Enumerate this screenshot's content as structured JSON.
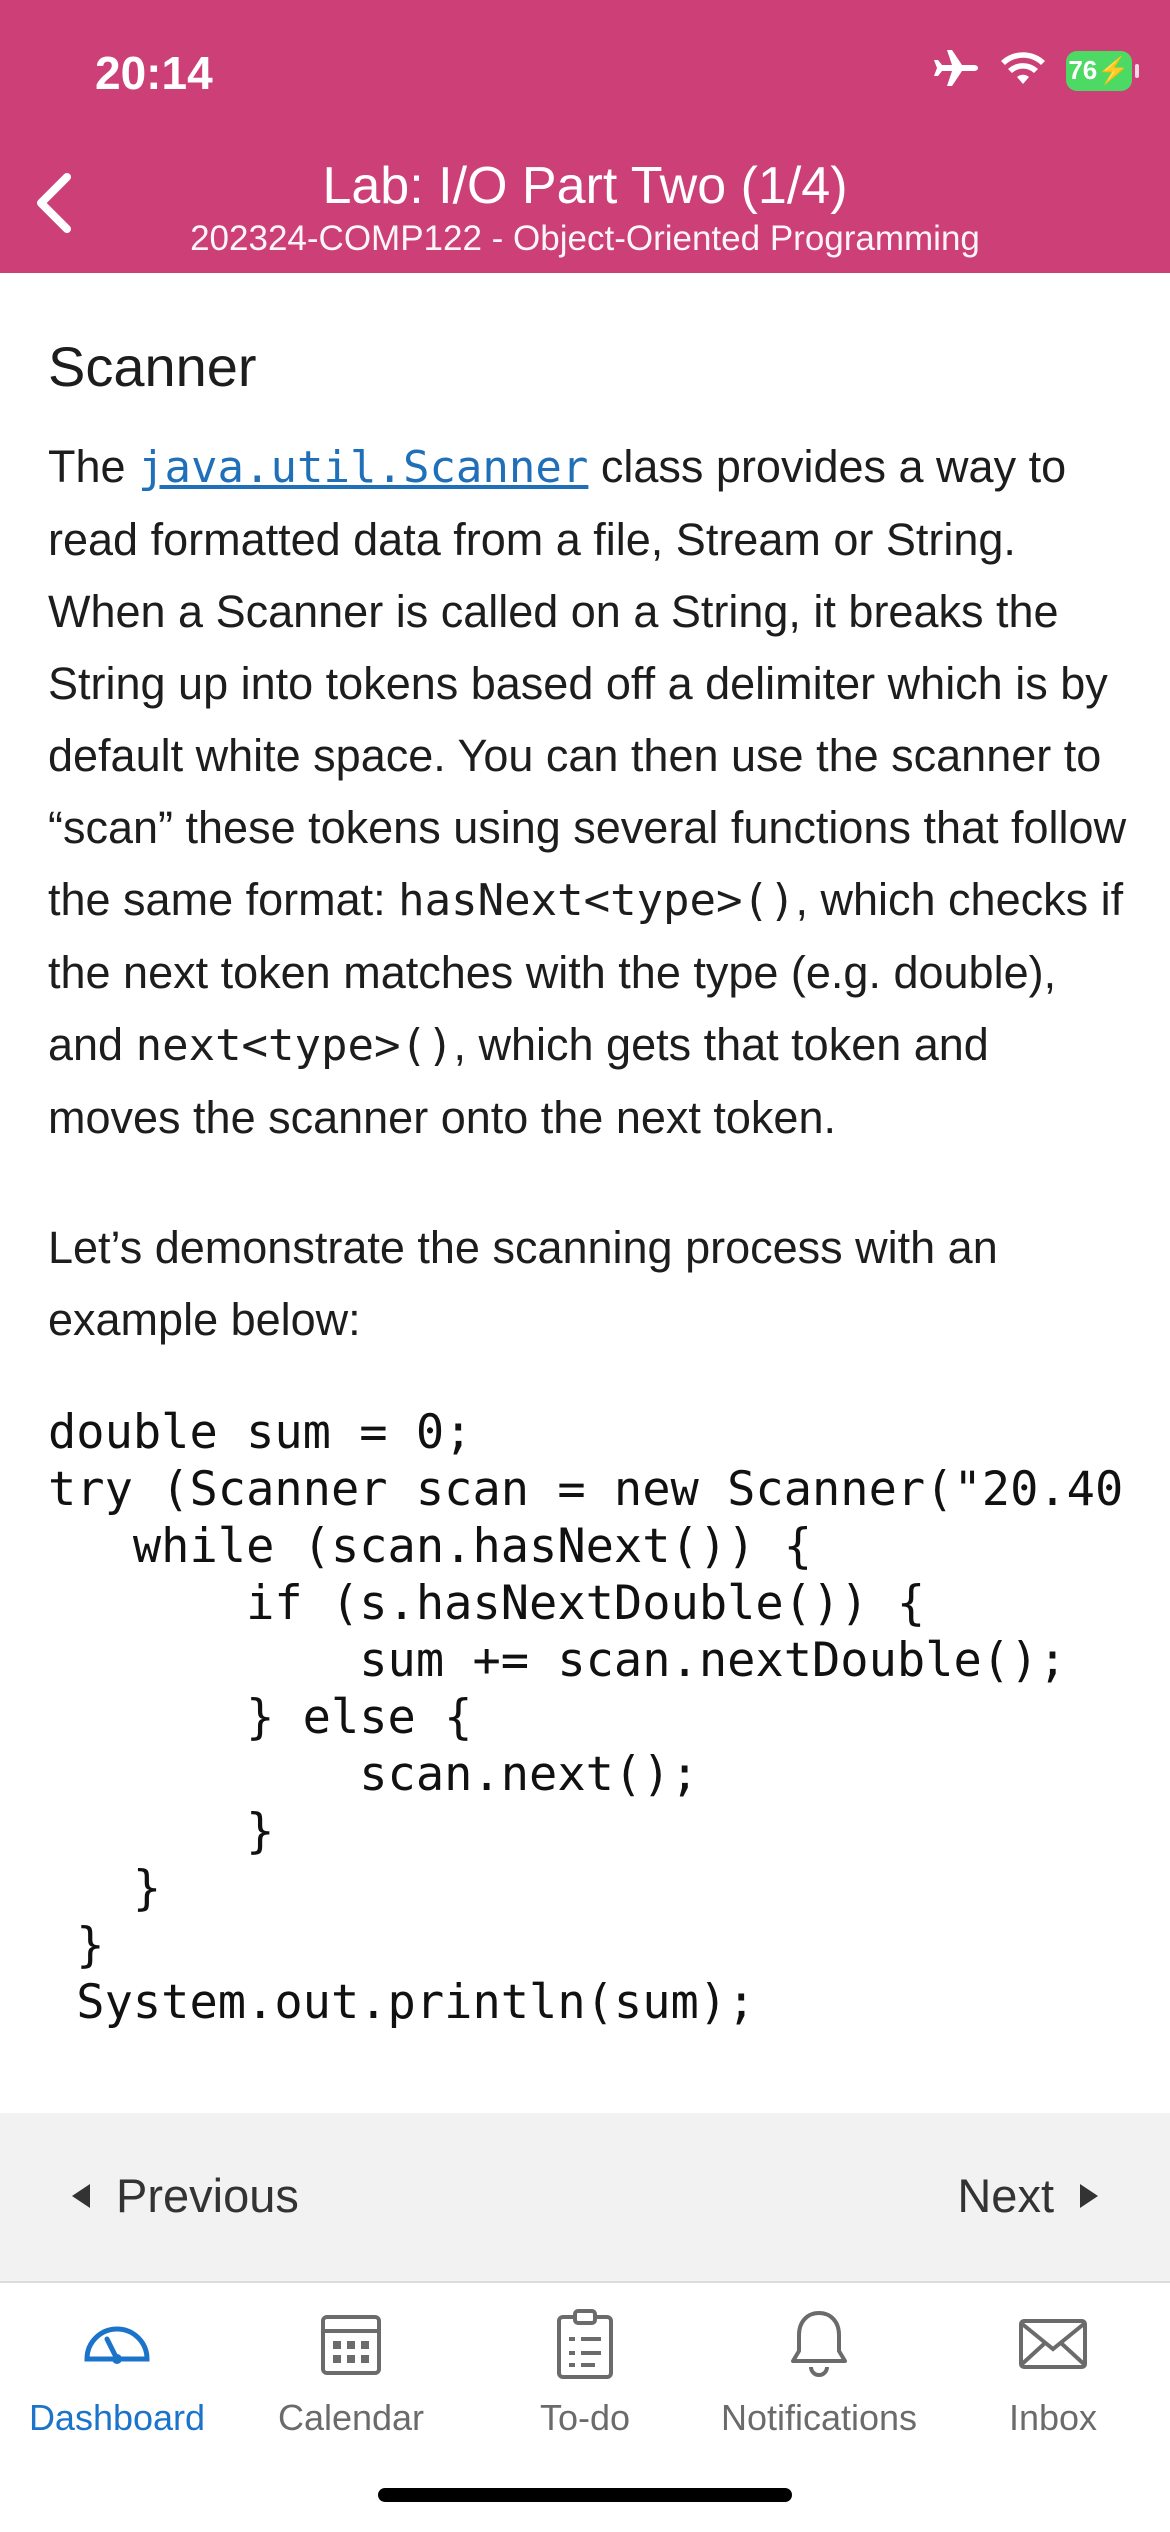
{
  "status_bar": {
    "time": "20:14",
    "battery": "76"
  },
  "header": {
    "title": "Lab: I/O Part Two (1/4)",
    "subtitle": "202324-COMP122 - Object-Oriented Programming"
  },
  "content": {
    "section_title": "Scanner",
    "para1": {
      "t1": "The ",
      "link": "java.util.Scanner",
      "t2": " class provides a way to read formatted data from a file, Stream or String. When a Scanner is called on a String, it breaks the String up into tokens based off a delimiter which is by default white space. You can then use the scanner to “scan” these tokens using several functions that follow the same format: ",
      "code1": "hasNext<type>()",
      "t3": ", which checks if the next token matches with the type (e.g. double), and ",
      "code2": "next<type>()",
      "t4": ", which gets that token and moves the scanner onto the next token."
    },
    "para2": "Let’s demonstrate the scanning process with an example below:",
    "code_lines": [
      "double sum = 0;",
      "try (Scanner scan = new Scanner(\"20.40",
      "   while (scan.hasNext()) {",
      "       if (s.hasNextDouble()) {",
      "           sum += scan.nextDouble();",
      "       } else {",
      "           scan.next();",
      "       }",
      "   }",
      " }",
      " System.out.println(sum);"
    ]
  },
  "nav": {
    "previous": "Previous",
    "next": "Next"
  },
  "tabs": [
    {
      "label": "Dashboard",
      "icon": "dashboard-icon",
      "active": true
    },
    {
      "label": "Calendar",
      "icon": "calendar-icon",
      "active": false
    },
    {
      "label": "To-do",
      "icon": "todo-icon",
      "active": false
    },
    {
      "label": "Notifications",
      "icon": "bell-icon",
      "active": false
    },
    {
      "label": "Inbox",
      "icon": "mail-icon",
      "active": false
    }
  ],
  "colors": {
    "header": "#cc3f77",
    "active_tab": "#1b74c9",
    "link": "#1f6fb9"
  }
}
